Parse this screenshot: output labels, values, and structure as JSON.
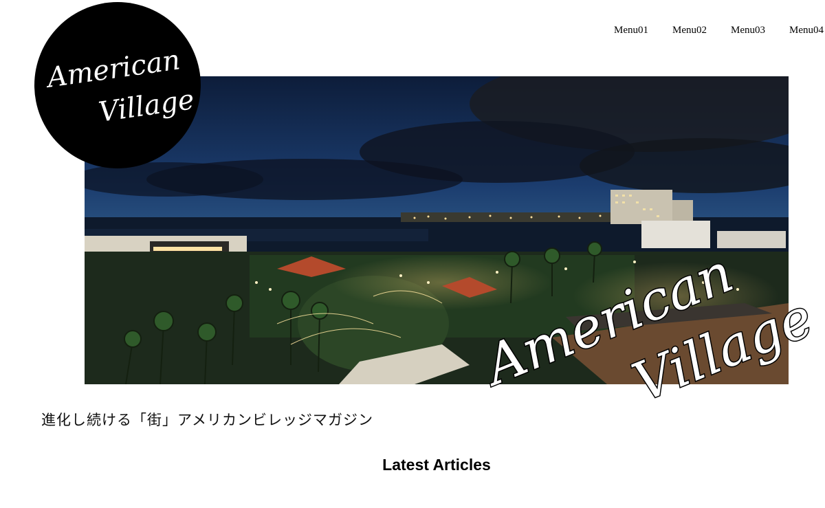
{
  "logo": {
    "line1": "American",
    "line2": "Village"
  },
  "nav": {
    "items": [
      {
        "label": "Menu01"
      },
      {
        "label": "Menu02"
      },
      {
        "label": "Menu03"
      },
      {
        "label": "Menu04"
      }
    ]
  },
  "hero": {
    "overlay_line1": "American",
    "overlay_line2": "Village"
  },
  "tagline": "進化し続ける「街」アメリカンビレッジマガジン",
  "section": {
    "title": "Latest Articles"
  },
  "colors": {
    "background": "#ffffff",
    "text": "#000000",
    "logo_bg": "#000000"
  }
}
